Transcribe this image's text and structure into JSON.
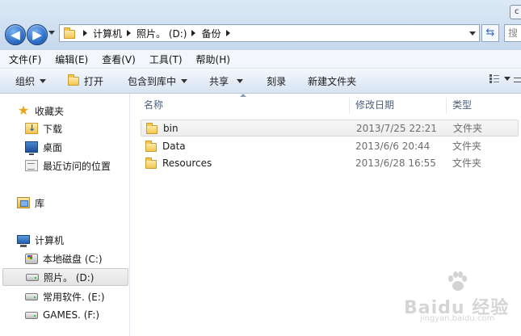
{
  "window": {
    "corner_button": "c"
  },
  "nav": {
    "back_icon": "back-arrow-icon",
    "forward_icon": "forward-arrow-icon",
    "refresh_icon": "refresh-icon",
    "search_placeholder": "搜"
  },
  "address": {
    "breadcrumbs": [
      "计算机",
      "照片。 (D:)",
      "备份"
    ]
  },
  "menu": {
    "items": [
      "文件(F)",
      "编辑(E)",
      "查看(V)",
      "工具(T)",
      "帮助(H)"
    ]
  },
  "toolbar": {
    "organize": "组织",
    "open": "打开",
    "include_in_library": "包含到库中",
    "share": "共享",
    "burn": "刻录",
    "new_folder": "新建文件夹"
  },
  "sidebar": {
    "favorites": {
      "label": "收藏夹",
      "items": [
        "下载",
        "桌面",
        "最近访问的位置"
      ]
    },
    "libraries": {
      "label": "库"
    },
    "computer": {
      "label": "计算机",
      "drives": [
        "本地磁盘 (C:)",
        "照片。 (D:)",
        "常用软件. (E:)",
        "GAMES. (F:)"
      ],
      "selected_drive": "照片。 (D:)"
    }
  },
  "columns": {
    "name": "名称",
    "modified": "修改日期",
    "type": "类型",
    "sort_column": "名称",
    "sort_direction": "ascending"
  },
  "files": [
    {
      "name": "bin",
      "modified": "2013/7/25 22:21",
      "type": "文件夹"
    },
    {
      "name": "Data",
      "modified": "2013/6/6 20:44",
      "type": "文件夹"
    },
    {
      "name": "Resources",
      "modified": "2013/6/28 16:55",
      "type": "文件夹"
    }
  ],
  "watermark": {
    "brand": "Baidu 经验",
    "url": "jingyan.baidu.com"
  },
  "colors": {
    "toolbar_gradient_top": "#f5f9fe",
    "toolbar_gradient_bottom": "#d8e4f2",
    "header_text": "#4c607a",
    "folder_yellow": "#f3c650",
    "nav_button_blue": "#2b6ec7"
  }
}
